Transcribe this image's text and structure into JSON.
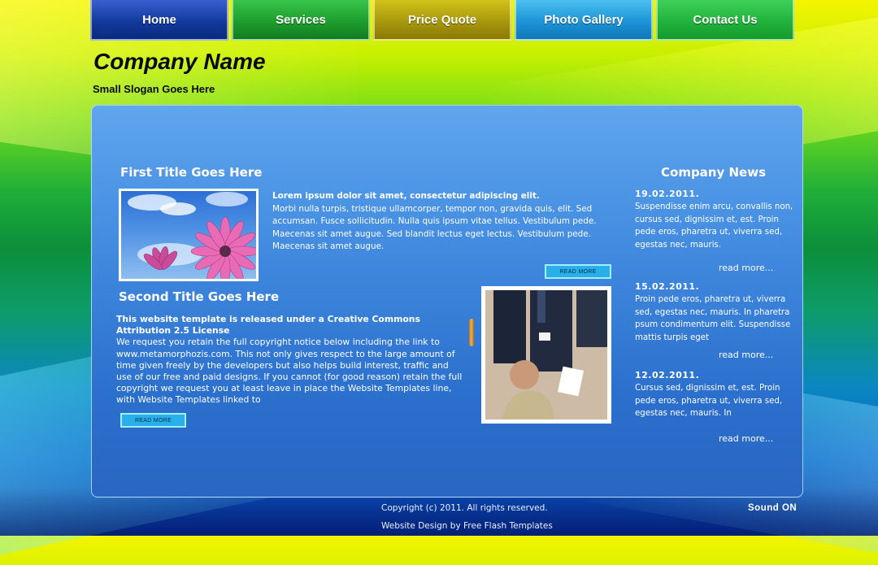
{
  "nav": {
    "items": [
      {
        "label": "Home"
      },
      {
        "label": "Services"
      },
      {
        "label": "Price Quote"
      },
      {
        "label": "Photo Gallery"
      },
      {
        "label": "Contact Us"
      }
    ]
  },
  "header": {
    "company_name": "Company Name",
    "slogan": "Small Slogan Goes Here"
  },
  "main": {
    "first_title": "First Title Goes Here",
    "first_lead": "Lorem ipsum dolor sit amet, consectetur adipiscing elit.",
    "first_body": "Morbi nulla turpis, tristique ullamcorper, tempor non, gravida quis, elit. Sed accumsan. Fusce sollicitudin. Nulla quis ipsum vitae tellus. Vestibulum pede. Maecenas sit amet augue. Sed blandit lectus eget lectus. Vestibulum pede. Maecenas sit amet augue.",
    "read_more_1": "READ MORE",
    "second_title": "Second Title Goes Here",
    "second_lead": "This website template is released under  a Creative Commons Attribution 2.5 License",
    "second_body": "We request you retain the full copyright notice below including the link to www.metamorphozis.com. This not only gives respect to the large amount of time given freely by the developers but also helps build interest, traffic and use of our free and paid designs. If you cannot (for good reason) retain the full copyright we request you at least leave in place the Website Templates line, with Website Templates  linked to",
    "read_more_2": "READ MORE"
  },
  "news": {
    "title": "Company News",
    "items": [
      {
        "date": "19.02.2011.",
        "text": "Suspendisse enim arcu, convallis non, cursus sed, dignissim et, est. Proin pede eros, pharetra ut, viverra sed, egestas nec, mauris.",
        "more": "read more..."
      },
      {
        "date": "15.02.2011.",
        "text": "Proin pede eros, pharetra ut, viverra sed, egestas nec, mauris. In pharetra psum condimentum elit. Suspendisse mattis turpis eget",
        "more": "read more..."
      },
      {
        "date": "12.02.2011.",
        "text": "Cursus sed, dignissim et, est. Proin pede eros, pharetra ut, viverra sed, egestas nec, mauris. In",
        "more": "read more..."
      }
    ]
  },
  "footer": {
    "copyright": "Copyright (c) 2011. All rights reserved.",
    "design_credit": "Website Design by Free Flash Templates",
    "sound": "Sound  ON"
  }
}
